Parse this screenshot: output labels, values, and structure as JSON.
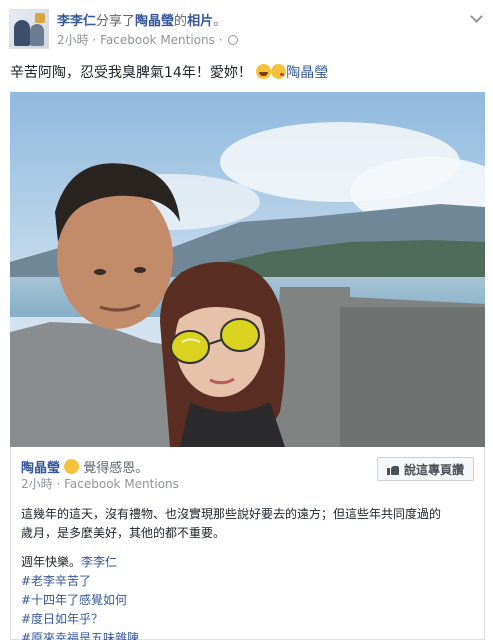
{
  "header": {
    "author": "李李仁",
    "action_text": "分享了",
    "target_name": "陶晶瑩",
    "target_suffix": "的",
    "object_text": "相片",
    "period": "。",
    "timestamp": "2小時",
    "separator": "·",
    "source": "Facebook Mentions",
    "privacy_icon": "globe-icon",
    "menu_icon": "chevron-down-icon"
  },
  "caption": {
    "text": "辛苦阿陶，忍受我臭脾氣14年！愛妳！",
    "emojis": [
      "laughing-emoji",
      "kissing-emoji"
    ],
    "mention": "陶晶瑩"
  },
  "shared": {
    "author": "陶晶瑩",
    "feeling": "覺得感恩。",
    "feeling_icon": "smile-emoji",
    "timestamp": "2小時",
    "separator": "·",
    "source": "Facebook Mentions",
    "like_button": "說這專頁讚",
    "body_lines": [
      "這幾年的這天，沒有禮物、也沒實現那些說好要去的遠方；但這些年共同度過的",
      "歲月，是多麼美好，其他的都不重要。"
    ],
    "anniversary": "週年快樂。",
    "anniversary_mention": "李李仁",
    "hashtags": [
      "#老李辛苦了",
      "#十四年了感覺如何",
      "#度日如年乎？",
      "#原來幸福是五味雜陳"
    ]
  },
  "colors": {
    "link": "#365899",
    "meta": "#90949c",
    "text": "#1d2129",
    "border": "#dddfe2"
  }
}
